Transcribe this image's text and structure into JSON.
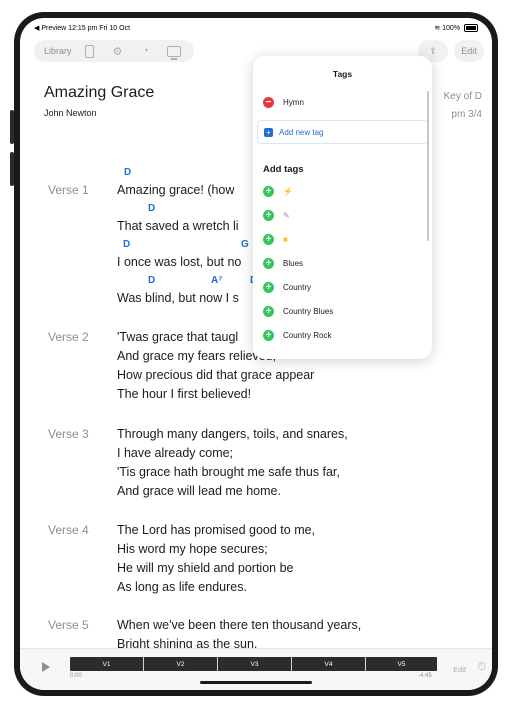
{
  "status": {
    "left": "◀ Preview  12:15 pm  Fri 10 Oct",
    "right": "100%"
  },
  "toolbar": {
    "library": "Library",
    "edit": "Edit"
  },
  "song": {
    "title": "Amazing Grace",
    "author": "John Newton",
    "key": "Key of D",
    "tempo": "pm   3/4"
  },
  "verses": [
    {
      "label": "Verse 1",
      "lines": [
        "Amazing grace! (how",
        "That saved a wretch li",
        "I once was lost, but no",
        "Was blind, but now I s"
      ]
    },
    {
      "label": "Verse 2",
      "lines": [
        "'Twas grace that taugl",
        "And grace my fears relieved;",
        "How precious did that grace appear",
        "The hour I first believed!"
      ]
    },
    {
      "label": "Verse 3",
      "lines": [
        "Through many dangers, toils, and snares,",
        "I have already come;",
        "'Tis grace hath brought me safe thus far,",
        "And grace will lead me home."
      ]
    },
    {
      "label": "Verse 4",
      "lines": [
        "The Lord has promised good to me,",
        "His word my hope secures;",
        "He will my shield and portion be",
        "As long as life endures."
      ]
    },
    {
      "label": "Verse 5",
      "lines": [
        "When we've been there ten thousand years,",
        "Bright shining as the sun,"
      ]
    }
  ],
  "chords": [
    "D",
    "D",
    "D",
    "G",
    "D",
    "A⁷",
    "D"
  ],
  "tags_popover": {
    "title": "Tags",
    "current": [
      {
        "label": "Hymn"
      }
    ],
    "add_new": "Add new tag",
    "add_heading": "Add tags",
    "available": [
      {
        "label": "⚡"
      },
      {
        "label": "✎"
      },
      {
        "label": "■"
      },
      {
        "label": "Blues"
      },
      {
        "label": "Country"
      },
      {
        "label": "Country Blues"
      },
      {
        "label": "Country Rock"
      }
    ]
  },
  "player": {
    "sections": [
      "V1",
      "V2",
      "V3",
      "V4",
      "V5"
    ],
    "elapsed": "0:00",
    "remaining": "-4:45",
    "edit": "Edit"
  },
  "colors": {
    "chord": "#1e6fd1",
    "remove": "#e5383b",
    "add": "#34c759"
  }
}
